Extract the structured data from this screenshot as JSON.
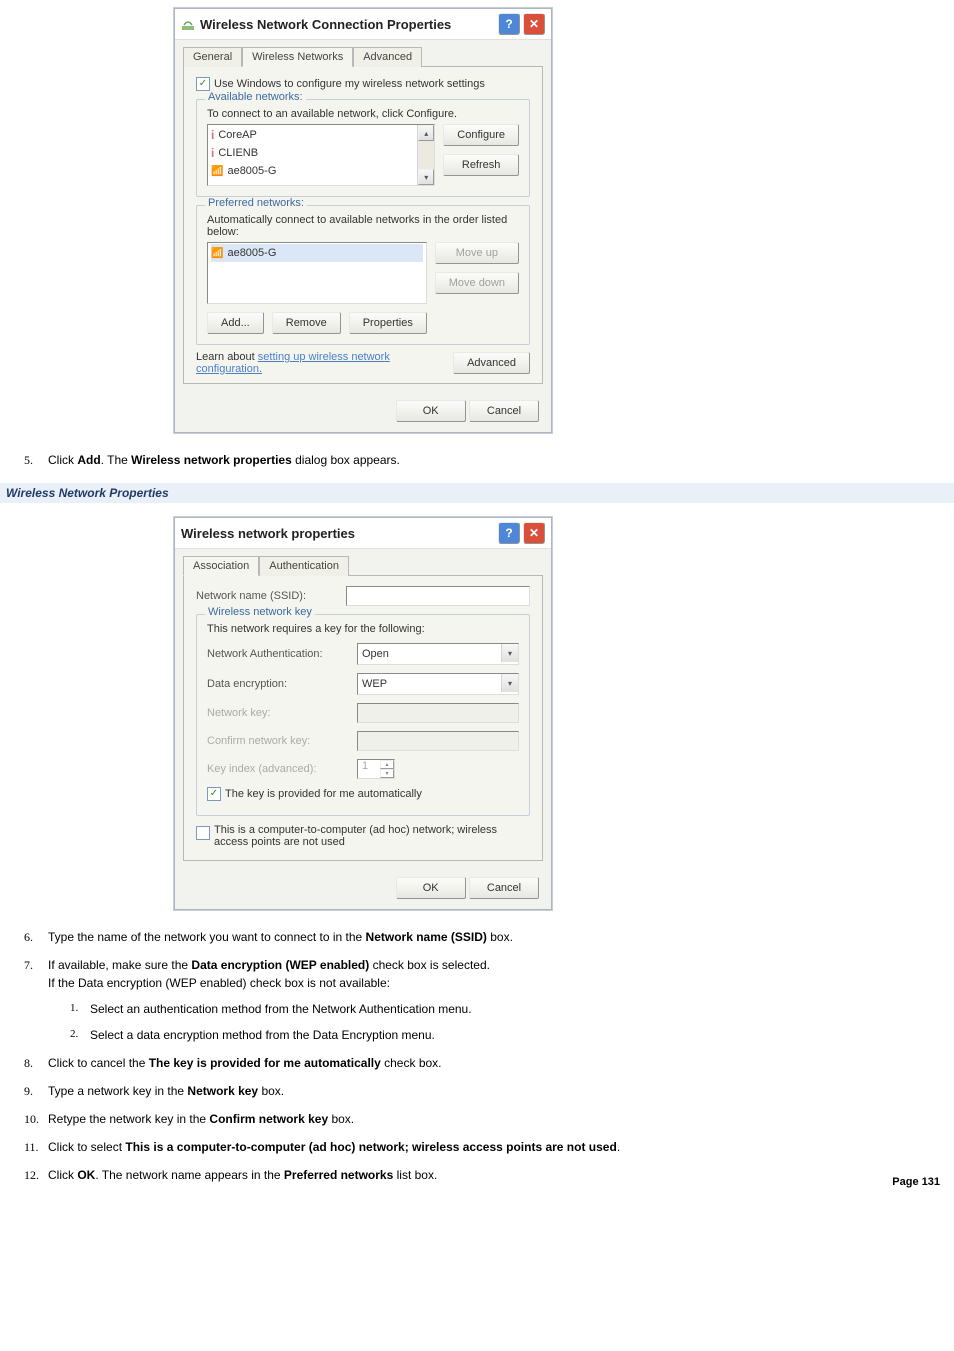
{
  "dialog1": {
    "title": "Wireless Network Connection Properties",
    "tabs": [
      "General",
      "Wireless Networks",
      "Advanced"
    ],
    "use_windows": "Use Windows to configure my wireless network settings",
    "available": {
      "legend": "Available networks:",
      "hint": "To connect to an available network, click Configure.",
      "items": [
        "CoreAP",
        "CLIENB",
        "ae8005-G"
      ],
      "configure": "Configure",
      "refresh": "Refresh"
    },
    "preferred": {
      "legend": "Preferred networks:",
      "hint": "Automatically connect to available networks in the order listed below:",
      "items": [
        "ae8005-G"
      ],
      "moveup": "Move up",
      "movedown": "Move down",
      "add": "Add...",
      "remove": "Remove",
      "properties": "Properties"
    },
    "learn": "Learn about ",
    "learn_link": "setting up wireless network configuration.",
    "advanced_btn": "Advanced",
    "ok": "OK",
    "cancel": "Cancel"
  },
  "step5": {
    "num": "5.",
    "pre": "Click ",
    "b1": "Add",
    "mid": ". The ",
    "b2": "Wireless network properties",
    "post": " dialog box appears."
  },
  "section2": "Wireless Network Properties",
  "dialog2": {
    "title": "Wireless network properties",
    "tabs": [
      "Association",
      "Authentication"
    ],
    "ssid_label": "Network name (SSID):",
    "key": {
      "legend": "Wireless network key",
      "requires": "This network requires a key for the following:",
      "auth_label": "Network Authentication:",
      "auth_value": "Open",
      "enc_label": "Data encryption:",
      "enc_value": "WEP",
      "key_label": "Network key:",
      "confirm_label": "Confirm network key:",
      "index_label": "Key index (advanced):",
      "index_value": "1",
      "auto_label": "The key is provided for me automatically"
    },
    "adhoc": "This is a computer-to-computer (ad hoc) network; wireless access points are not used",
    "ok": "OK",
    "cancel": "Cancel"
  },
  "steps": {
    "6": {
      "num": "6.",
      "pre": "Type the name of the network you want to connect to in the ",
      "b": "Network name (SSID)",
      "post": " box."
    },
    "7": {
      "num": "7.",
      "pre": "If available, make sure the ",
      "b": "Data encryption (WEP enabled)",
      "mid": " check box is selected.",
      "line2": "If the Data encryption (WEP enabled) check box is not available:",
      "sub1": {
        "num": "1.",
        "txt": "Select an authentication method from the Network Authentication menu."
      },
      "sub2": {
        "num": "2.",
        "txt": "Select a data encryption method from the Data Encryption menu."
      }
    },
    "8": {
      "num": "8.",
      "pre": "Click to cancel the ",
      "b": "The key is provided for me automatically",
      "post": " check box."
    },
    "9": {
      "num": "9.",
      "pre": "Type a network key in the ",
      "b": "Network key",
      "post": " box."
    },
    "10": {
      "num": "10.",
      "pre": "Retype the network key in the ",
      "b": "Confirm network key",
      "post": " box."
    },
    "11": {
      "num": "11.",
      "pre": "Click to select ",
      "b": "This is a computer-to-computer (ad hoc) network; wireless access points are not used",
      "post": "."
    },
    "12": {
      "num": "12.",
      "pre": "Click ",
      "b": "OK",
      "mid": ". The network name appears in the ",
      "b2": "Preferred networks",
      "post": " list box."
    }
  },
  "page_label": "Page 131"
}
